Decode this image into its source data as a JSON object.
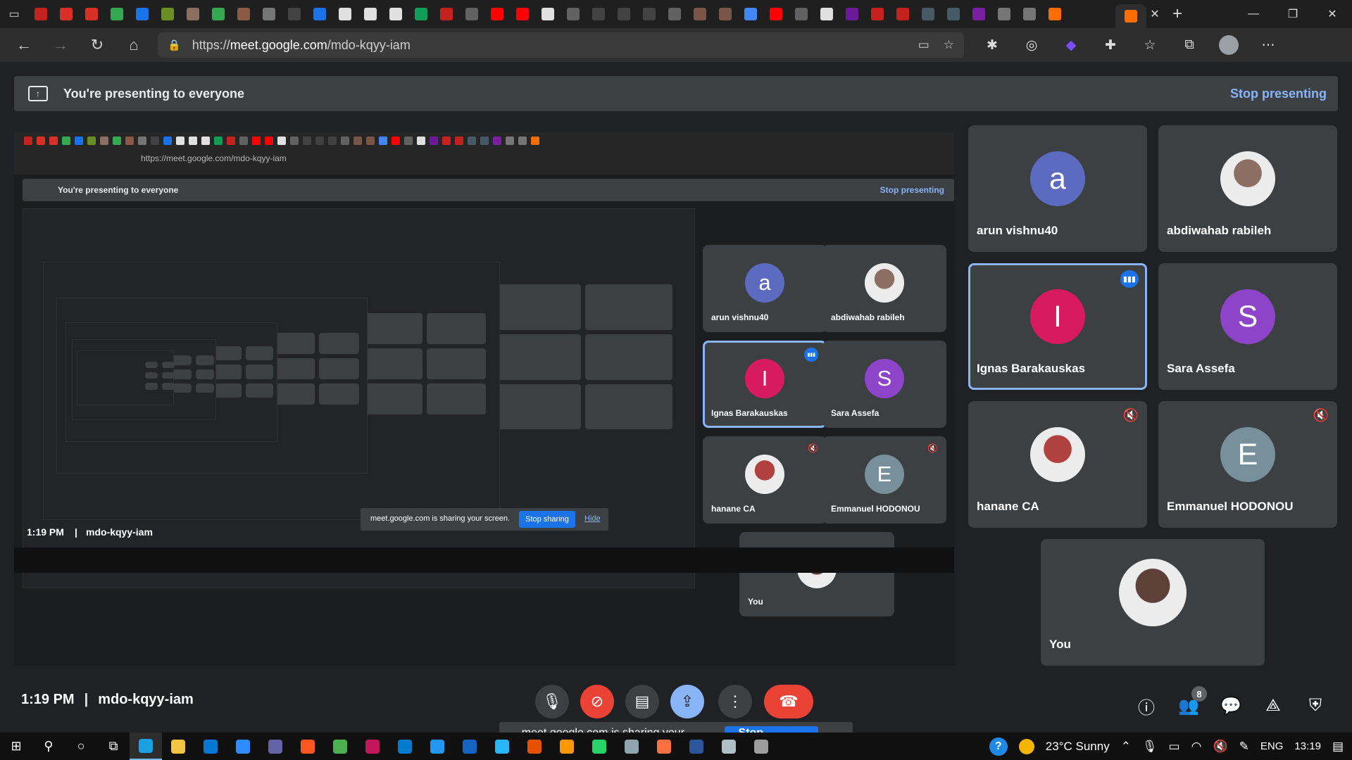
{
  "browser": {
    "url_prefix": "https://",
    "url_host": "meet.google.com",
    "url_path": "/mdo-kqyy-iam",
    "tab_favicon_colors": [
      "#c5221f",
      "#d93025",
      "#d93025",
      "#34a853",
      "#1a73e8",
      "#6b8e23",
      "#8d6e63",
      "#34a853",
      "#8a5a44",
      "#757575",
      "#424242",
      "#1a73e8",
      "#e0e0e0",
      "#e0e0e0",
      "#e0e0e0",
      "#0f9d58",
      "#c5221f",
      "#616161",
      "#ff0000",
      "#ff0000",
      "#e0e0e0",
      "#616161",
      "#424242",
      "#424242",
      "#424242",
      "#616161",
      "#795548",
      "#795548",
      "#4285f4",
      "#ff0000",
      "#616161",
      "#e0e0e0",
      "#6a1b9a",
      "#c5221f",
      "#c5221f",
      "#455a64",
      "#455a64",
      "#7b1fa2",
      "#757575",
      "#757575",
      "#ff6d00"
    ]
  },
  "banner": {
    "text": "You're presenting to everyone",
    "stop_label": "Stop presenting"
  },
  "participants": [
    {
      "name": "arun vishnu40",
      "initial": "a",
      "color": "#5c6bc0",
      "photo": false,
      "muted": false,
      "speaking": false
    },
    {
      "name": "abdiwahab rabileh",
      "initial": "",
      "color": "#8d6e63",
      "photo": true,
      "muted": false,
      "speaking": false
    },
    {
      "name": "Ignas Barakauskas",
      "initial": "I",
      "color": "#d81b60",
      "photo": false,
      "muted": false,
      "speaking": true
    },
    {
      "name": "Sara Assefa",
      "initial": "S",
      "color": "#8e44c8",
      "photo": false,
      "muted": false,
      "speaking": false
    },
    {
      "name": "hanane CA",
      "initial": "",
      "color": "#b0413e",
      "photo": true,
      "muted": true,
      "speaking": false
    },
    {
      "name": "Emmanuel HODONOU",
      "initial": "E",
      "color": "#78909c",
      "photo": false,
      "muted": true,
      "speaking": false
    },
    {
      "name": "You",
      "initial": "",
      "color": "#5d4037",
      "photo": true,
      "muted": false,
      "speaking": false
    }
  ],
  "meeting": {
    "time": "1:19 PM",
    "code": "mdo-kqyy-iam",
    "people_count": "8"
  },
  "share_popup": {
    "message": "meet.google.com is sharing your screen.",
    "stop_label": "Stop sharing",
    "hide_label": "Hide"
  },
  "taskbar": {
    "weather": "23°C  Sunny",
    "language": "ENG",
    "clock": "13:19",
    "apps": [
      {
        "name": "edge",
        "color": "#1ba1e2"
      },
      {
        "name": "file-explorer",
        "color": "#f4c542"
      },
      {
        "name": "mail",
        "color": "#0078d4"
      },
      {
        "name": "zoom",
        "color": "#2d8cff"
      },
      {
        "name": "teams",
        "color": "#6264a7"
      },
      {
        "name": "app-orange",
        "color": "#ff5722"
      },
      {
        "name": "chrome",
        "color": "#4caf50"
      },
      {
        "name": "phpstorm",
        "color": "#c2185b"
      },
      {
        "name": "vscode",
        "color": "#007acc"
      },
      {
        "name": "network-tool",
        "color": "#2196f3"
      },
      {
        "name": "app-blue",
        "color": "#1565c0"
      },
      {
        "name": "app-arrow",
        "color": "#29b6f6"
      },
      {
        "name": "app-html",
        "color": "#e65100"
      },
      {
        "name": "sublime",
        "color": "#ff9800"
      },
      {
        "name": "whatsapp",
        "color": "#25d366"
      },
      {
        "name": "app-gray",
        "color": "#90a4ae"
      },
      {
        "name": "app-shop",
        "color": "#ff7043"
      },
      {
        "name": "word",
        "color": "#2b579a"
      },
      {
        "name": "app-monitor",
        "color": "#b0bec5"
      },
      {
        "name": "settings",
        "color": "#9e9e9e"
      }
    ]
  }
}
